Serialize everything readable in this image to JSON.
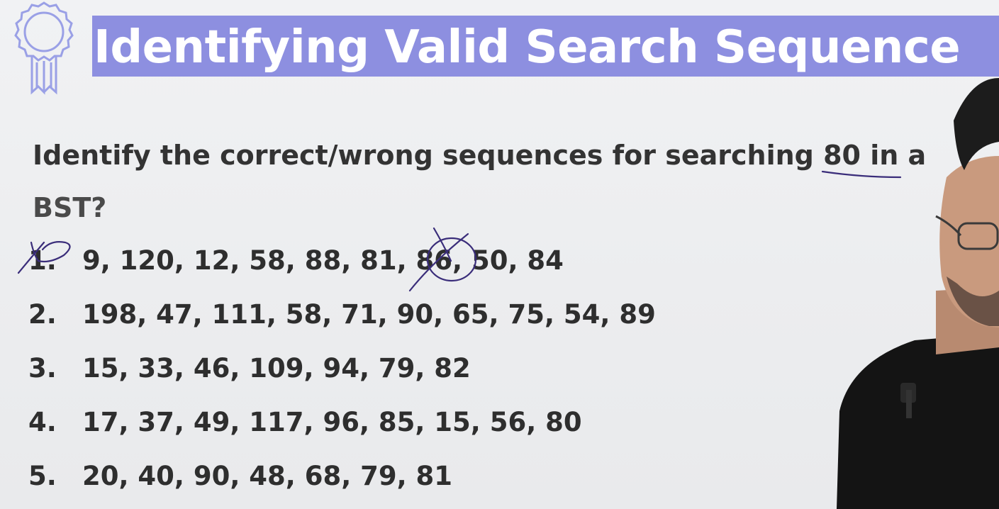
{
  "title": "Identifying Valid Search Sequence",
  "question": {
    "line1": "Identify the correct/wrong sequences for searching 80 in a",
    "line2": "BST?"
  },
  "sequences": [
    {
      "num": "1.",
      "values": "9, 120, 12, 58, 88, 81, 86, 50, 84"
    },
    {
      "num": "2.",
      "values": "198, 47, 111, 58, 71, 90, 65, 75, 54, 89"
    },
    {
      "num": "3.",
      "values": "15, 33, 46, 109, 94, 79, 82"
    },
    {
      "num": "4.",
      "values": "17, 37, 49, 117, 96, 85, 15, 56, 80"
    },
    {
      "num": "5.",
      "values": "20, 40, 90, 48, 68, 79, 81"
    }
  ],
  "colors": {
    "title_band": "#8d8fe0",
    "title_text": "#ffffff",
    "ink": "#3a2d7a",
    "badge": "#9aa0e6"
  },
  "icons": {
    "badge": "award-ribbon-icon"
  }
}
